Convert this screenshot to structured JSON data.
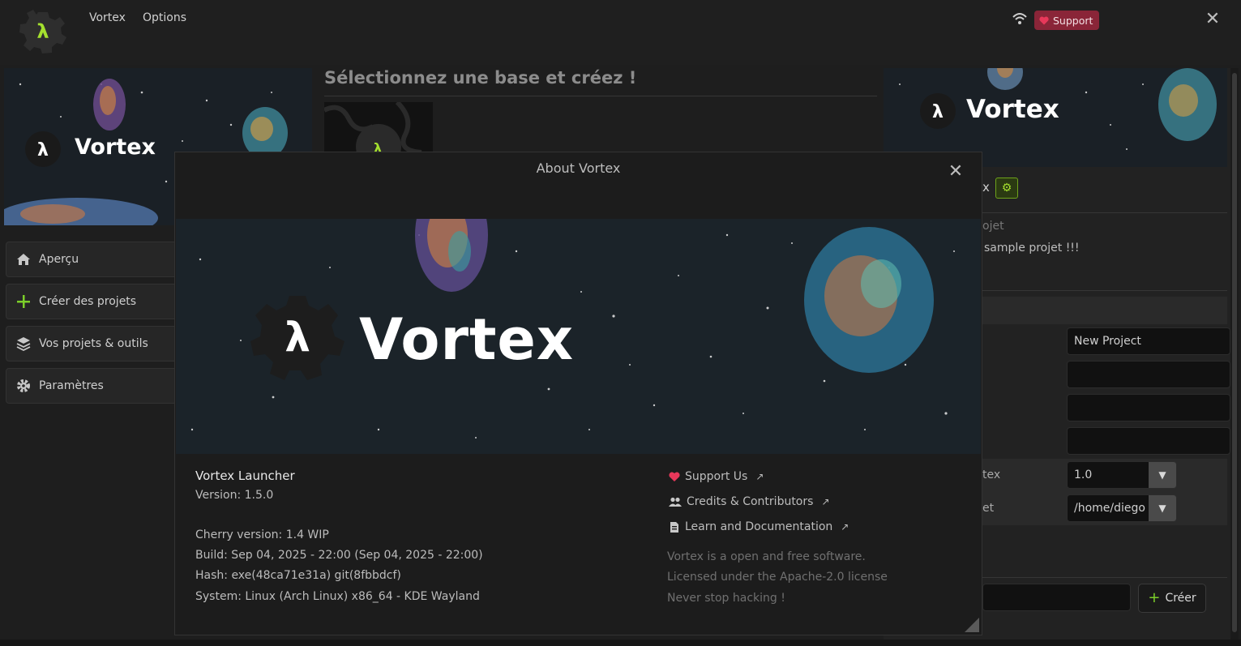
{
  "menu": {
    "items": [
      "Vortex",
      "Options"
    ]
  },
  "header": {
    "support_label": "Support"
  },
  "sidebar": {
    "items": [
      {
        "label": "Aperçu",
        "icon": "home-icon"
      },
      {
        "label": "Créer des projets",
        "icon": "plus-icon"
      },
      {
        "label": "Vos projets & outils",
        "icon": "layers-icon"
      },
      {
        "label": "Paramètres",
        "icon": "gear-icon"
      }
    ]
  },
  "brand": {
    "name": "Vortex"
  },
  "center": {
    "title": "Sélectionnez une base et créez !"
  },
  "right": {
    "partial_title": "x",
    "partial_label": "ojet",
    "partial_desc": "sample projet !!!",
    "fields": {
      "project_name": "New Project",
      "version_label": "tex",
      "version_value": "1.0",
      "path_label": "et",
      "path_value": "/home/diego"
    },
    "create_label": "Créer"
  },
  "modal": {
    "title": "About Vortex",
    "app_name": "Vortex Launcher",
    "version": "Version: 1.5.0",
    "cherry": "Cherry version: 1.4 WIP",
    "build": "Build: Sep 04, 2025 - 22:00 (Sep 04, 2025 - 22:00)",
    "hash": "Hash:  exe(48ca71e31a) git(8fbbdcf)",
    "system": "System: Linux (Arch Linux) x86_64 - KDE Wayland",
    "links": [
      {
        "label": "Support Us",
        "icon": "heart-icon"
      },
      {
        "label": "Credits & Contributors",
        "icon": "users-icon"
      },
      {
        "label": "Learn and Documentation",
        "icon": "document-icon"
      }
    ],
    "footer": [
      "Vortex is a open and free software.",
      "Licensed under the  Apache-2.0 license",
      "Never stop hacking !"
    ]
  },
  "colors": {
    "accent": "#a4e02e",
    "support": "#8a2538",
    "heart": "#e8385a"
  }
}
